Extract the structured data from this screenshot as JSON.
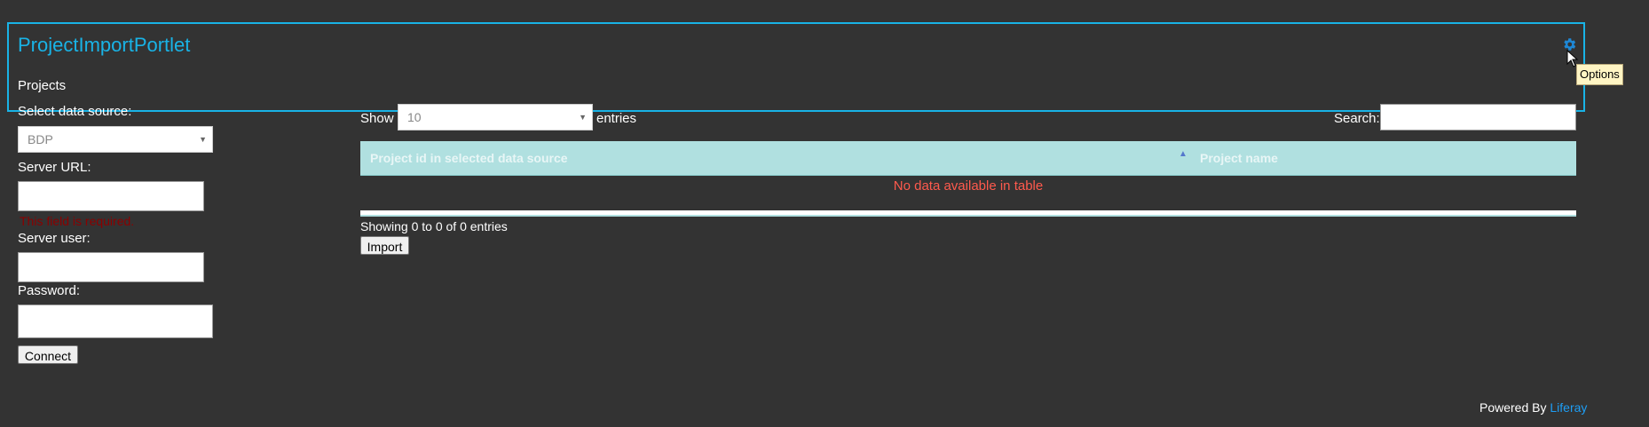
{
  "portlet": {
    "title": "ProjectImportPortlet",
    "options_tooltip": "Options",
    "section": "Projects"
  },
  "form": {
    "data_source_label": "Select data source:",
    "data_source_value": "BDP",
    "server_url_label": "Server URL:",
    "server_url_value": "",
    "server_url_error": "This field is required.",
    "server_user_label": "Server user:",
    "server_user_value": "",
    "password_label": "Password:",
    "password_value": "",
    "connect_button": "Connect"
  },
  "table": {
    "show_label": "Show",
    "page_size": "10",
    "entries_label": "entries",
    "search_label": "Search:",
    "search_value": "",
    "columns": [
      "Project id in selected data source",
      "Project name"
    ],
    "empty_message": "No data available in table",
    "info": "Showing 0 to 0 of 0 entries",
    "import_button": "Import"
  },
  "footer": {
    "powered_by": "Powered By",
    "brand": "Liferay"
  },
  "icons": {
    "options": "gear-icon",
    "sort": "sort-asc-icon"
  },
  "colors": {
    "accent": "#19b3e6",
    "error": "#8b0000",
    "empty_message": "#ff5a4d",
    "table_header": "#b0e0e0",
    "background": "#333333"
  }
}
